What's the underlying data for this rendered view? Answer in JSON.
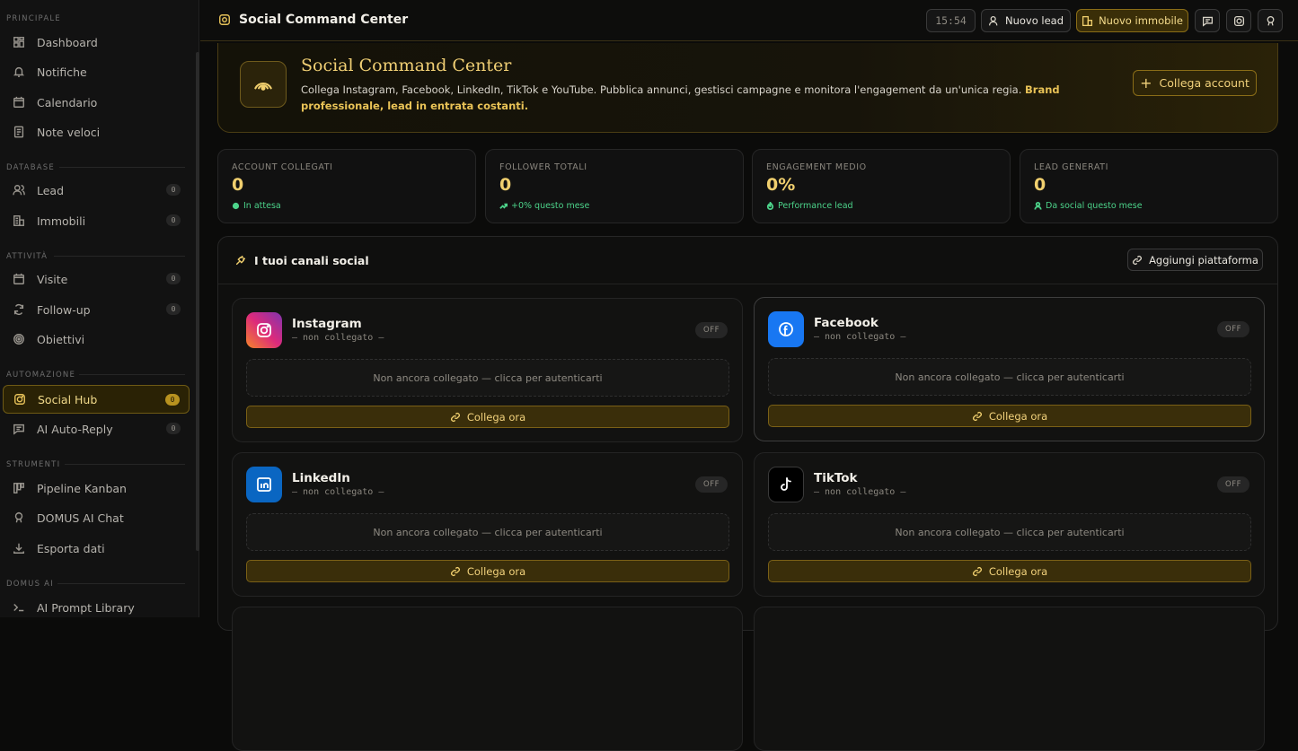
{
  "sidebar": {
    "sections": [
      {
        "title": "PRINCIPALE"
      },
      {
        "title": "DATABASE"
      },
      {
        "title": "ATTIVITÀ"
      },
      {
        "title": "AUTOMAZIONE"
      },
      {
        "title": "STRUMENTI"
      },
      {
        "title": "DOMUS AI"
      }
    ],
    "items": [
      {
        "label": "Dashboard",
        "icon": "dashboard-icon"
      },
      {
        "label": "Notifiche",
        "icon": "bell-icon"
      },
      {
        "label": "Calendario",
        "icon": "calendar-icon"
      },
      {
        "label": "Note veloci",
        "icon": "note-icon"
      },
      {
        "label": "Lead",
        "icon": "users-icon",
        "badge": "0"
      },
      {
        "label": "Immobili",
        "icon": "building-icon",
        "badge": "0"
      },
      {
        "label": "Visite",
        "icon": "calendar-icon",
        "badge": "0"
      },
      {
        "label": "Follow-up",
        "icon": "refresh-icon",
        "badge": "0"
      },
      {
        "label": "Obiettivi",
        "icon": "target-icon"
      },
      {
        "label": "Social Hub",
        "icon": "instagram-icon",
        "badge": "0",
        "active": true
      },
      {
        "label": "AI Auto-Reply",
        "icon": "message-icon",
        "badge": "0"
      },
      {
        "label": "Pipeline Kanban",
        "icon": "kanban-icon"
      },
      {
        "label": "DOMUS AI Chat",
        "icon": "bot-icon"
      },
      {
        "label": "Esporta dati",
        "icon": "download-icon"
      },
      {
        "label": "AI Prompt Library",
        "icon": "terminal-icon"
      }
    ]
  },
  "topbar": {
    "title": "Social Command Center",
    "clock": "15:54",
    "new_lead_label": "Nuovo lead",
    "new_property_label": "Nuovo immobile"
  },
  "hero": {
    "title": "Social Command Center",
    "description": "Collega Instagram, Facebook, LinkedIn, TikTok e YouTube. Pubblica annunci, gestisci campagne e monitora l'engagement da un'unica regia. ",
    "highlight": "Brand professionale, lead in entrata costanti.",
    "button_label": "Collega account"
  },
  "stats": [
    {
      "label": "ACCOUNT COLLEGATI",
      "value": "0",
      "sub": "In attesa"
    },
    {
      "label": "FOLLOWER TOTALI",
      "value": "0",
      "sub": "+0% questo mese"
    },
    {
      "label": "ENGAGEMENT MEDIO",
      "value": "0%",
      "sub": "Performance lead"
    },
    {
      "label": "LEAD GENERATI",
      "value": "0",
      "sub": "Da social questo mese"
    }
  ],
  "channels_panel": {
    "title": "I tuoi canali social",
    "add_button_label": "Aggiungi piattaforma"
  },
  "channels": [
    {
      "name": "Instagram",
      "status": "— non collegato —",
      "badge": "OFF",
      "note": "Non ancora collegato — clicca per autenticarti",
      "button": "Collega ora",
      "color": "#e1306c"
    },
    {
      "name": "Facebook",
      "status": "— non collegato —",
      "badge": "OFF",
      "note": "Non ancora collegato — clicca per autenticarti",
      "button": "Collega ora",
      "color": "#1877f2"
    },
    {
      "name": "LinkedIn",
      "status": "— non collegato —",
      "badge": "OFF",
      "note": "Non ancora collegato — clicca per autenticarti",
      "button": "Collega ora",
      "color": "#0a66c2"
    },
    {
      "name": "TikTok",
      "status": "— non collegato —",
      "badge": "OFF",
      "note": "Non ancora collegato — clicca per autenticarti",
      "button": "Collega ora",
      "color": "#000000"
    }
  ]
}
